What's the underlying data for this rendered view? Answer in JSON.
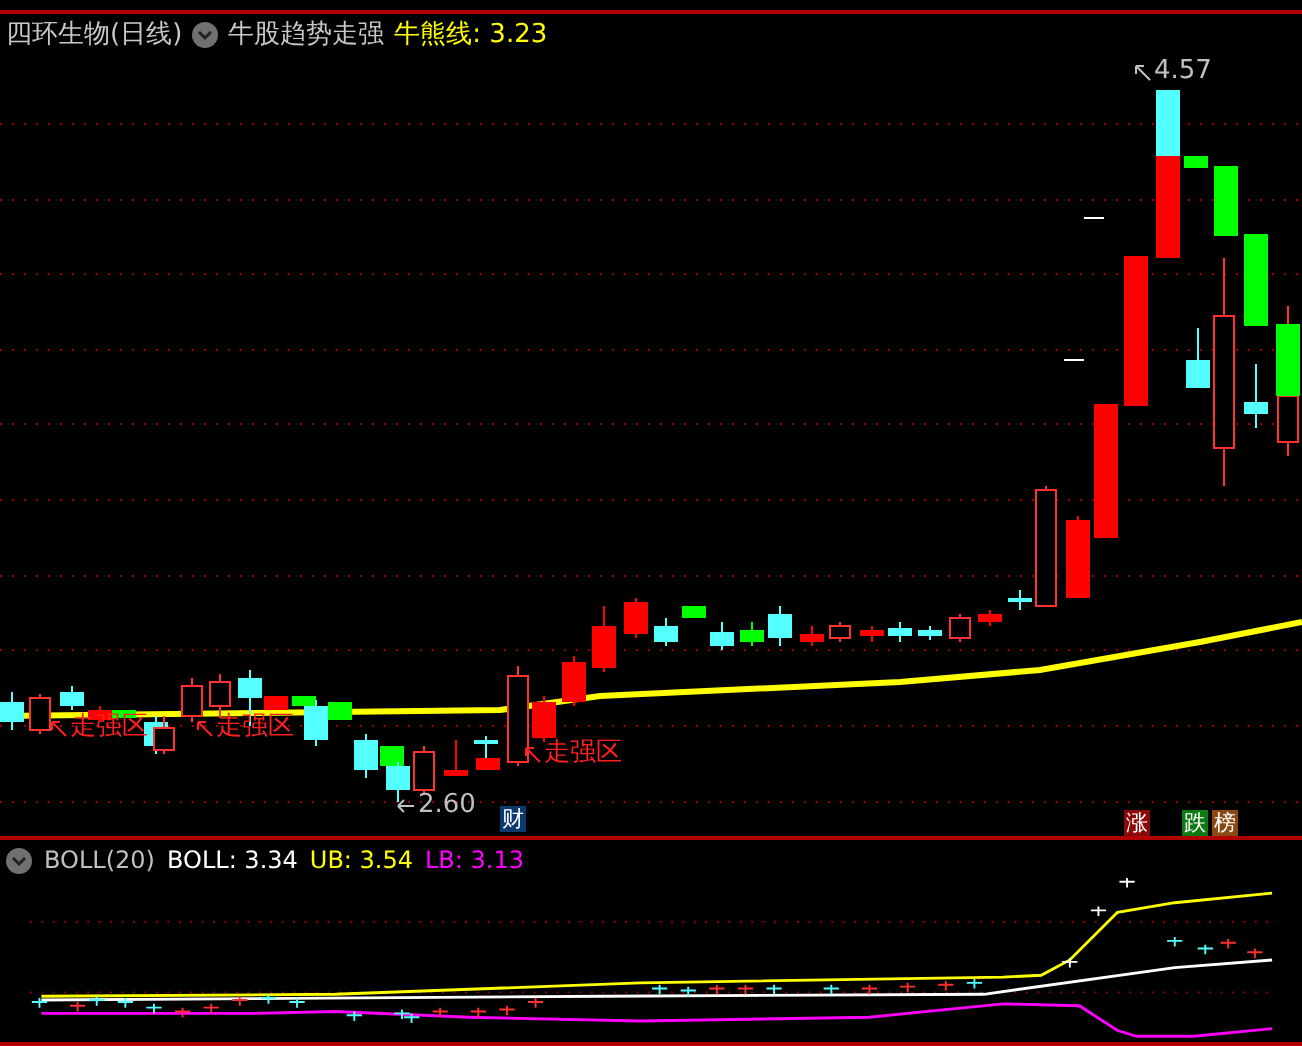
{
  "title": {
    "stock": "四环生物(日线)",
    "indicator": "牛股趋势走强",
    "line_value": "牛熊线: 3.23"
  },
  "markers": [
    {
      "kind": "zone",
      "text": "走强区"
    },
    {
      "kind": "zone",
      "text": "走强区"
    },
    {
      "kind": "zone",
      "text": "走强区"
    },
    {
      "kind": "low",
      "text": "2.60"
    },
    {
      "kind": "high",
      "text": "4.57"
    }
  ],
  "badges": [
    {
      "text": "财",
      "color": "#0b3a6e"
    },
    {
      "text": "涨",
      "color": "#8a0a0a"
    },
    {
      "text": "跌",
      "color": "#0e7a12"
    },
    {
      "text": "榜",
      "color": "#8a4a12"
    }
  ],
  "indicator": {
    "name": "BOLL(20)",
    "values": [
      {
        "label": "BOLL: 3.34",
        "color": "#ffffff"
      },
      {
        "label": "UB: 3.54",
        "color": "#ffff00"
      },
      {
        "label": "LB: 3.13",
        "color": "#ff00ff"
      }
    ]
  }
}
